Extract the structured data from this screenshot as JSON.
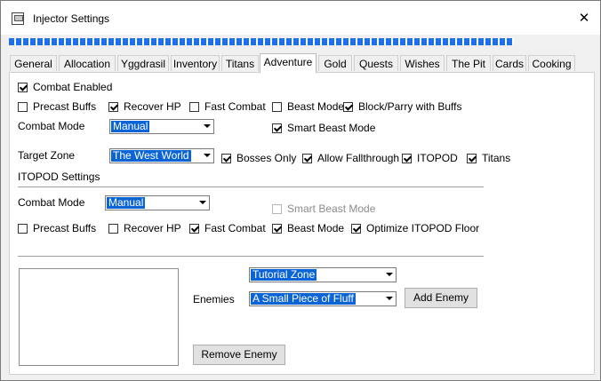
{
  "window": {
    "title": "Injector Settings",
    "close_glyph": "✕"
  },
  "progress": {
    "fraction": 1.0
  },
  "tabs": [
    {
      "label": "General",
      "active": false
    },
    {
      "label": "Allocation",
      "active": false
    },
    {
      "label": "Yggdrasil",
      "active": false
    },
    {
      "label": "Inventory",
      "active": false
    },
    {
      "label": "Titans",
      "active": false
    },
    {
      "label": "Adventure",
      "active": true
    },
    {
      "label": "Gold",
      "active": false
    },
    {
      "label": "Quests",
      "active": false
    },
    {
      "label": "Wishes",
      "active": false
    },
    {
      "label": "The Pit",
      "active": false
    },
    {
      "label": "Cards",
      "active": false
    },
    {
      "label": "Cooking",
      "active": false
    }
  ],
  "adventure": {
    "combat_enabled": {
      "label": "Combat Enabled",
      "checked": true
    },
    "precast_buffs": {
      "label": "Precast Buffs",
      "checked": false
    },
    "recover_hp": {
      "label": "Recover HP",
      "checked": true
    },
    "fast_combat": {
      "label": "Fast Combat",
      "checked": false
    },
    "beast_mode": {
      "label": "Beast Mode",
      "checked": false
    },
    "block_parry": {
      "label": "Block/Parry with Buffs",
      "checked": true
    },
    "combat_mode_label": "Combat Mode",
    "combat_mode_value": "Manual",
    "smart_beast_mode": {
      "label": "Smart Beast Mode",
      "checked": true
    },
    "target_zone_label": "Target Zone",
    "target_zone_value": "The West World",
    "bosses_only": {
      "label": "Bosses Only",
      "checked": true
    },
    "allow_fallthrough": {
      "label": "Allow Fallthrough",
      "checked": true
    },
    "itopod": {
      "label": "ITOPOD",
      "checked": true
    },
    "titans": {
      "label": "Titans",
      "checked": true
    }
  },
  "itopod": {
    "section_label": "ITOPOD Settings",
    "combat_mode_label": "Combat Mode",
    "combat_mode_value": "Manual",
    "smart_beast_mode": {
      "label": "Smart Beast Mode",
      "checked": false,
      "disabled": true
    },
    "precast_buffs": {
      "label": "Precast Buffs",
      "checked": false
    },
    "recover_hp": {
      "label": "Recover HP",
      "checked": false
    },
    "fast_combat": {
      "label": "Fast Combat",
      "checked": true
    },
    "beast_mode": {
      "label": "Beast Mode",
      "checked": true
    },
    "optimize_floor": {
      "label": "Optimize ITOPOD Floor",
      "checked": true
    }
  },
  "enemies": {
    "zone_value": "Tutorial Zone",
    "label": "Enemies",
    "enemy_value": "A Small Piece of Fluff",
    "add_button": "Add Enemy",
    "remove_button": "Remove Enemy",
    "list_items": []
  },
  "colors": {
    "selection": "#0a64d6",
    "progress": "#1f6fe5",
    "panel": "#ffffff",
    "chrome": "#f0f0f0"
  }
}
